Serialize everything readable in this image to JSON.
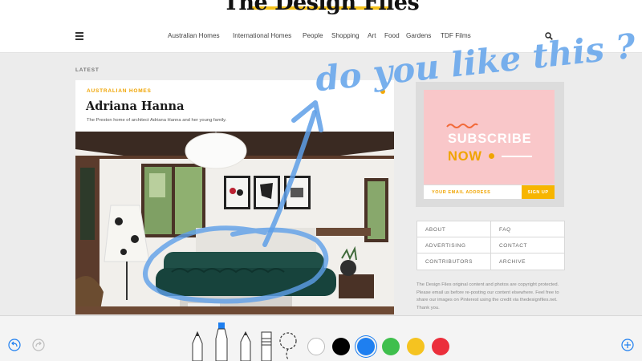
{
  "header": {
    "logo": "The Design Files",
    "nav": [
      "Australian Homes",
      "International Homes",
      "People",
      "Shopping",
      "Art",
      "Food",
      "Gardens",
      "TDF Films"
    ]
  },
  "main": {
    "section_label": "LATEST",
    "article": {
      "category": "AUSTRALIAN HOMES",
      "title": "Adriana Hanna",
      "subtitle": "The Preston home of architect Adriana Hanna and her young family."
    }
  },
  "sidebar": {
    "subscribe": {
      "line1": "SUBSCRIBE",
      "line2": "NOW",
      "email_placeholder": "YOUR EMAIL ADDRESS",
      "signup_label": "SIGN UP"
    },
    "links": [
      "ABOUT",
      "FAQ",
      "ADVERTISING",
      "CONTACT",
      "CONTRIBUTORS",
      "ARCHIVE"
    ],
    "copyright": "The Design Files original content and photos are copyright protected. Please email us before re-posting our content elsewhere. Feel free to share our images on Pinterest using the credit via thedesignfiles.net. Thank you."
  },
  "markup": {
    "handwriting": "do you like this ?",
    "ink_color": "#6aa8ec"
  },
  "toolbar": {
    "tools": [
      "undo-icon",
      "redo-icon",
      "pen-icon",
      "marker-icon",
      "pencil-icon",
      "eraser-icon",
      "lasso-icon",
      "add-icon"
    ],
    "colors": [
      "#ffffff",
      "#000000",
      "#1e7ff0",
      "#3fbf4d",
      "#f5c320",
      "#eb2e3b"
    ],
    "selected_color": "#1e7ff0"
  },
  "colors": {
    "accent_yellow": "#f5c21b",
    "subscribe_pink": "#f9c7c9",
    "signup_orange": "#f7b500"
  }
}
